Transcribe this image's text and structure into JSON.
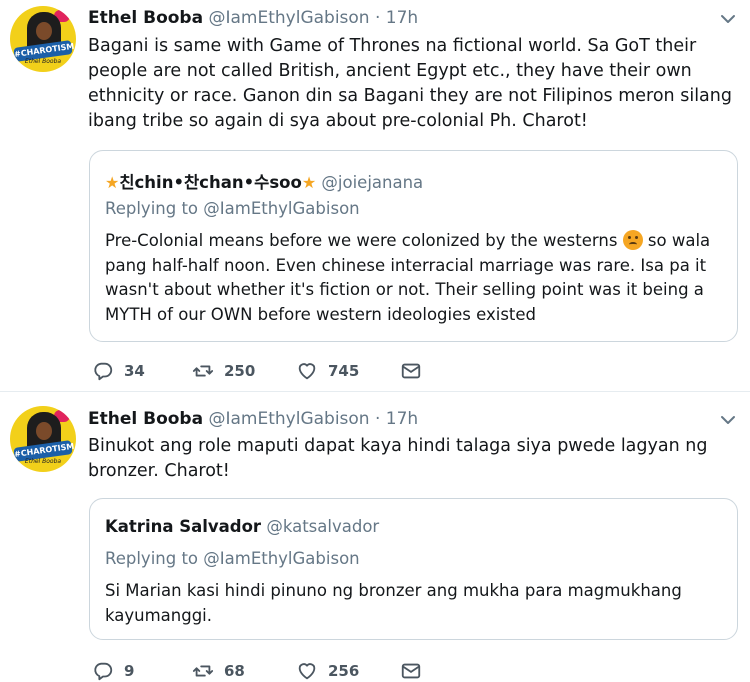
{
  "tweets": [
    {
      "author_name": "Ethel Booba",
      "author_handle": "@IamEthylGabison",
      "separator": "·",
      "time": "17h",
      "avatar_text": "#CHAROTISM",
      "avatar_subtext": "Ethel Booba",
      "text": "Bagani is same with Game of Thrones na fictional world. Sa GoT their people are not called British, ancient Egypt etc., they have their own ethnicity or race. Ganon din sa Bagani they are not Filipinos meron silang ibang tribe so again di sya about pre-colonial Ph. Charot!",
      "quote": {
        "name": "친chin•찬chan•수soo",
        "handle": "@joiejanana",
        "replying_to": "Replying to @IamEthylGabison",
        "text_part1": "Pre-Colonial means before we were colonized by the westerns ",
        "text_part2": " so wala pang half-half noon. Even chinese interracial marriage was rare. Isa pa it wasn't about whether it's fiction or not. Their selling point was it being a MYTH of our OWN before western ideologies existed"
      },
      "replies": "34",
      "retweets": "250",
      "likes": "745"
    },
    {
      "author_name": "Ethel Booba",
      "author_handle": "@IamEthylGabison",
      "separator": "·",
      "time": "17h",
      "avatar_text": "#CHAROTISM",
      "avatar_subtext": "Ethel Booba",
      "text": "Binukot ang role maputi dapat kaya hindi talaga siya pwede lagyan ng bronzer. Charot!",
      "quote": {
        "name": "Katrina Salvador",
        "handle": "@katsalvador",
        "replying_to": "Replying to @IamEthylGabison",
        "text": "Si Marian kasi hindi pinuno ng bronzer ang mukha para magmukhang kayumanggi."
      },
      "replies": "9",
      "retweets": "68",
      "likes": "256"
    }
  ],
  "icons": {
    "chevron": "chevron-down-icon",
    "reply": "reply-icon",
    "retweet": "retweet-icon",
    "like": "heart-icon",
    "dm": "envelope-icon",
    "quote_name_decoration": "star-icon",
    "quote_emoji": "face-emoji-icon"
  },
  "colors": {
    "text": "#14171a",
    "muted": "#657786",
    "border": "#ccd6dd",
    "avatar_bg": "#f2d01a"
  }
}
